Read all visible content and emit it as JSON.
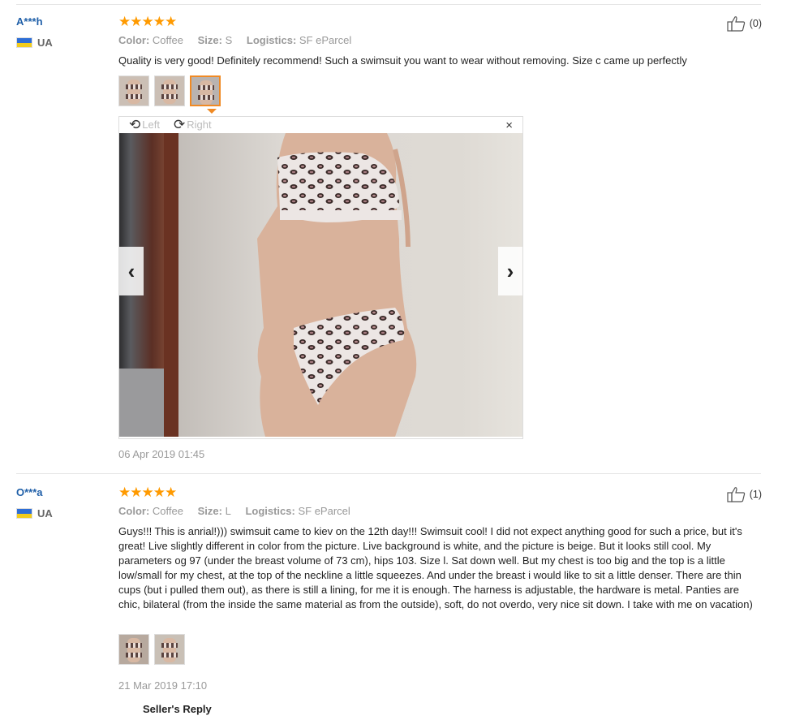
{
  "reviews": [
    {
      "user": "A***h",
      "country": "UA",
      "stars": "★★★★★",
      "color_label": "Color:",
      "color_value": "Coffee",
      "size_label": "Size:",
      "size_value": "S",
      "logistics_label": "Logistics:",
      "logistics_value": "SF eParcel",
      "helpful_count": "(0)",
      "text": "Quality is very good! Definitely recommend! Such a swimsuit you want to wear without removing. Size c came up perfectly",
      "viewer": {
        "rotate_left": "Left",
        "rotate_right": "Right",
        "close": "×",
        "prev": "‹",
        "next": "›"
      },
      "date": "06 Apr 2019 01:45"
    },
    {
      "user": "O***a",
      "country": "UA",
      "stars": "★★★★★",
      "color_label": "Color:",
      "color_value": "Coffee",
      "size_label": "Size:",
      "size_value": "L",
      "logistics_label": "Logistics:",
      "logistics_value": "SF eParcel",
      "helpful_count": "(1)",
      "text": "Guys!!! This is anrial!))) swimsuit came to kiev on the 12th day!!! Swimsuit cool! I did not expect anything good for such a price, but it's great! Live slightly different in color from the picture. Live background is white, and the picture is beige. But it looks still cool. My parameters og 97 (under the breast volume of 73 cm), hips 103. Size l. Sat down well. But my chest is too big and the top is a little low/small for my chest, at the top of the neckline a little squeezes. And under the breast i would like to sit a little denser. There are thin cups (but i pulled them out), as there is still a lining, for me it is enough. The harness is adjustable, the hardware is metal. Panties are chic, bilateral (from the inside the same material as from the outside), soft, do not overdo, very nice sit down. I take with me on vacation)",
      "date": "21 Mar 2019 17:10",
      "seller_reply": "Seller's Reply"
    }
  ],
  "colors": {
    "accent_stars": "#ff9a00",
    "username": "#1f5fa8",
    "active_thumb": "#f08a24"
  }
}
